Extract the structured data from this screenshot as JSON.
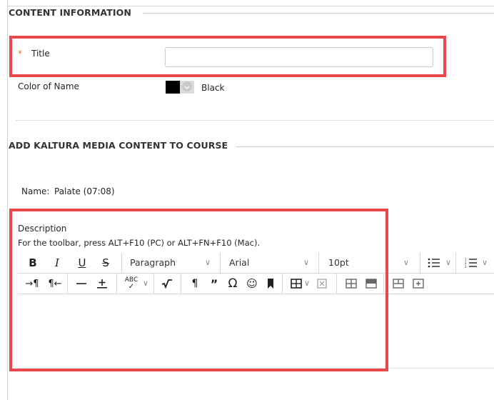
{
  "content_information": {
    "heading": "CONTENT INFORMATION",
    "title_label": "Title",
    "required_mark": "*",
    "title_value": "",
    "color_label": "Color of Name",
    "color_value": "Black",
    "color_swatch": "#000000"
  },
  "kaltura": {
    "heading": "ADD KALTURA MEDIA CONTENT TO COURSE",
    "name_label": "Name:",
    "name_value": "Palate (07:08)"
  },
  "description": {
    "label": "Description",
    "hint": "For the toolbar, press ALT+F10 (PC) or ALT+FN+F10 (Mac).",
    "body": ""
  },
  "toolbar": {
    "bold": "B",
    "italic": "I",
    "underline": "U",
    "strike": "S",
    "paragraph_format": "Paragraph",
    "font_family": "Arial",
    "font_size": "10pt"
  },
  "colors": {
    "highlight": "#e8474c",
    "required": "#e0752b"
  }
}
